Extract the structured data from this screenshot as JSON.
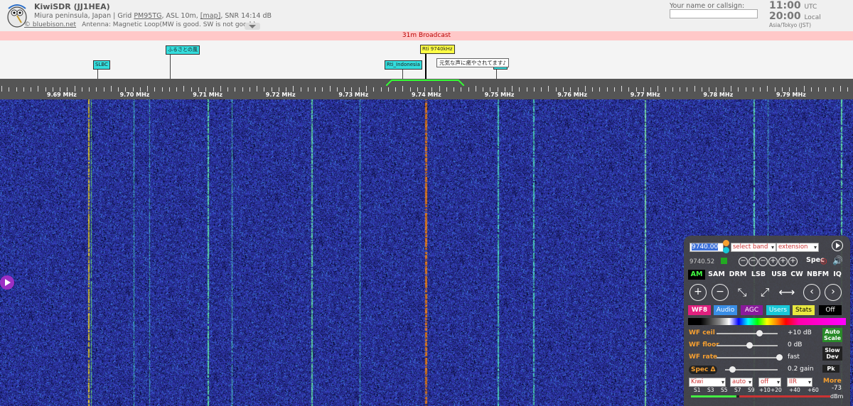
{
  "header": {
    "title": "KiwiSDR (JJ1HEA)",
    "location_prefix": "Miura peninsula, Japan | Grid ",
    "grid": "PM95TG",
    "asl": ", ASL 10m, ",
    "map_label": "[map]",
    "snr": ", SNR 14:14 dB",
    "credit_link": "© bluebison.net",
    "antenna": "Antenna: Magnetic Loop(MW is good. SW is not good.)",
    "name_label": "Your name or callsign:",
    "name_value": "",
    "utc_time": "11:00",
    "utc_label": "UTC",
    "local_time": "20:00",
    "local_label": "Local",
    "timezone": "Asia/Tokyo (JST)"
  },
  "band_name": "31m Broadcast",
  "stations": {
    "slbc": "SLBC",
    "furusato": "ふるさとの風",
    "rti_indonesia": "Rti_Indonesia",
    "rti_selected": "Rti 9740kHz",
    "tooltip": "元気な声に癒やされてます♪"
  },
  "scale": {
    "labels": [
      "9.69 MHz",
      "9.70 MHz",
      "9.71 MHz",
      "9.72 MHz",
      "9.73 MHz",
      "9.74 MHz",
      "9.75 MHz",
      "9.76 MHz",
      "9.77 MHz",
      "9.78 MHz",
      "9.79 MHz"
    ]
  },
  "control": {
    "freq_input": "9740.00",
    "band_select": "select band",
    "ext_select": "extension",
    "freq_display": "9740.52",
    "spec": "Spec",
    "modes": [
      "AM",
      "SAM",
      "DRM",
      "LSB",
      "USB",
      "CW",
      "NBFM",
      "IQ"
    ],
    "active_mode": "AM",
    "tabs": [
      "WF8",
      "Audio",
      "AGC",
      "Users",
      "Stats",
      "Off"
    ],
    "tab_colors": [
      "#e0207e",
      "#3a8ee6",
      "#8a1a9c",
      "#18c8d8",
      "#e8e840",
      "#000000"
    ],
    "wf_ceil_label": "WF ceil",
    "wf_ceil_value": "+10 dB",
    "wf_floor_label": "WF floor",
    "wf_floor_value": "0 dB",
    "wf_rate_label": "WF rate",
    "wf_rate_value": "fast",
    "spec_delta_label": "Spec Δ",
    "spec_delta_value": "0.2 gain",
    "auto_scale": "Auto Scale",
    "slow_dev": "Slow Dev",
    "pk": "Pk",
    "bottom_selects": [
      "Kiwi",
      "auto",
      "off",
      "IIR"
    ],
    "more": "More",
    "smeter_labels": [
      "S1",
      "S3",
      "S5",
      "S7",
      "S9",
      "+10",
      "+20",
      "+40",
      "+60"
    ],
    "smeter_value": "-73",
    "smeter_unit": "dBm"
  },
  "colors": {
    "band_bar": "#ffc8c8",
    "station_cyan": "#33dddd",
    "station_yellow": "#ffff44",
    "waterfall_bg": "#1a1f6e",
    "accent_orange": "#f7a030"
  }
}
